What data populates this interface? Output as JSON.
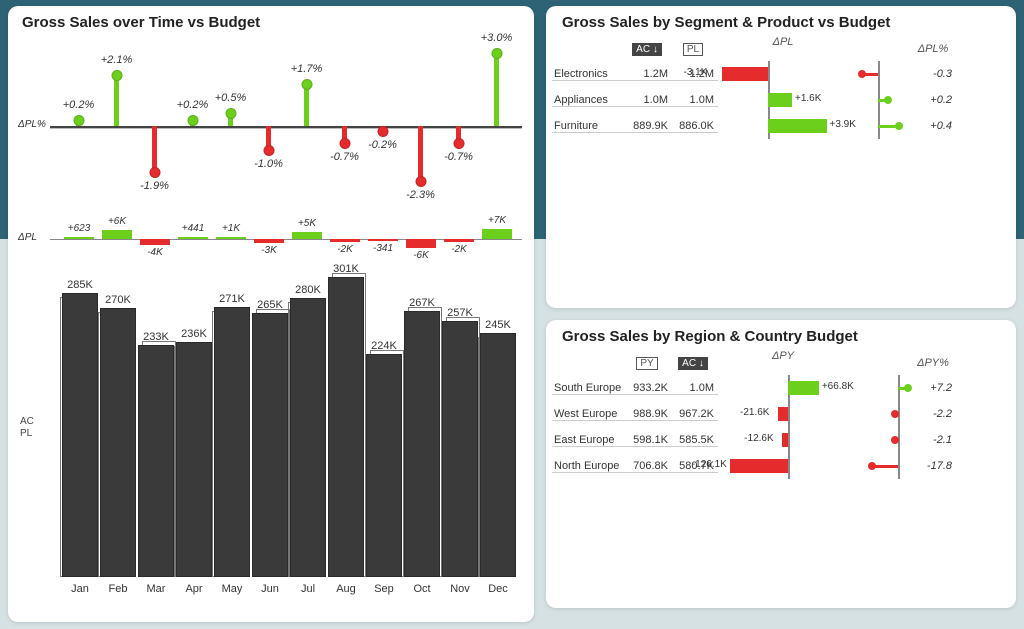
{
  "main": {
    "title": "Gross Sales over Time vs Budget",
    "delta_pl_pct_label": "ΔPL%",
    "delta_pl_label": "ΔPL",
    "ac_label": "AC",
    "pl_label": "PL"
  },
  "seg": {
    "title": "Gross Sales by Segment & Product vs Budget",
    "hdr_ac": "AC ↓",
    "hdr_pl": "PL",
    "hdr_dpl": "ΔPL",
    "hdr_dpl_pct": "ΔPL%"
  },
  "reg": {
    "title": "Gross Sales by Region & Country Budget",
    "hdr_py": "PY",
    "hdr_ac": "AC ↓",
    "hdr_dpy": "ΔPY",
    "hdr_dpy_pct": "ΔPY%"
  },
  "chart_data": [
    {
      "type": "bar",
      "id": "gross_sales_over_time",
      "title": "Gross Sales over Time vs Budget",
      "categories": [
        "Jan",
        "Feb",
        "Mar",
        "Apr",
        "May",
        "Jun",
        "Jul",
        "Aug",
        "Sep",
        "Oct",
        "Nov",
        "Dec"
      ],
      "series": [
        {
          "name": "AC",
          "values": [
            285,
            270,
            233,
            236,
            271,
            265,
            280,
            301,
            224,
            267,
            257,
            245
          ],
          "unit": "K"
        },
        {
          "name": "ΔPL",
          "values": [
            623,
            6000,
            -4000,
            441,
            1000,
            -3000,
            5000,
            -2000,
            -341,
            -6000,
            -2000,
            7000
          ],
          "labels": [
            "+623",
            "+6K",
            "-4K",
            "+441",
            "+1K",
            "-3K",
            "+5K",
            "-2K",
            "-341",
            "-6K",
            "-2K",
            "+7K"
          ]
        },
        {
          "name": "ΔPL%",
          "values": [
            0.2,
            2.1,
            -1.9,
            0.2,
            0.5,
            -1.0,
            1.7,
            -0.7,
            -0.2,
            -2.3,
            -0.7,
            3.0
          ],
          "labels": [
            "+0.2%",
            "+2.1%",
            "-1.9%",
            "+0.2%",
            "+0.5%",
            "-1.0%",
            "+1.7%",
            "-0.7%",
            "-0.2%",
            "-2.3%",
            "-0.7%",
            "+3.0%"
          ]
        }
      ]
    },
    {
      "type": "bar",
      "id": "gross_sales_by_segment",
      "title": "Gross Sales by Segment & Product vs Budget",
      "categories": [
        "Electronics",
        "Appliances",
        "Furniture"
      ],
      "series": [
        {
          "name": "AC",
          "values": [
            "1.2M",
            "1.0M",
            "889.9K"
          ]
        },
        {
          "name": "PL",
          "values": [
            "1.2M",
            "1.0M",
            "886.0K"
          ]
        },
        {
          "name": "ΔPL",
          "values": [
            -3.1,
            1.6,
            3.9
          ],
          "unit": "K",
          "labels": [
            "-3.1K",
            "+1.6K",
            "+3.9K"
          ]
        },
        {
          "name": "ΔPL%",
          "values": [
            -0.3,
            0.2,
            0.4
          ],
          "labels": [
            "-0.3",
            "+0.2",
            "+0.4"
          ]
        }
      ]
    },
    {
      "type": "bar",
      "id": "gross_sales_by_region",
      "title": "Gross Sales by Region & Country Budget",
      "categories": [
        "South Europe",
        "West Europe",
        "East Europe",
        "North Europe"
      ],
      "series": [
        {
          "name": "PY",
          "values": [
            "933.2K",
            "988.9K",
            "598.1K",
            "706.8K"
          ]
        },
        {
          "name": "AC",
          "values": [
            "1.0M",
            "967.2K",
            "585.5K",
            "580.7K"
          ]
        },
        {
          "name": "ΔPY",
          "values": [
            66.8,
            -21.6,
            -12.6,
            -126.1
          ],
          "unit": "K",
          "labels": [
            "+66.8K",
            "-21.6K",
            "-12.6K",
            "-126.1K"
          ]
        },
        {
          "name": "ΔPY%",
          "values": [
            7.2,
            -2.2,
            -2.1,
            -17.8
          ],
          "labels": [
            "+7.2",
            "-2.2",
            "-2.1",
            "-17.8"
          ]
        }
      ]
    }
  ]
}
